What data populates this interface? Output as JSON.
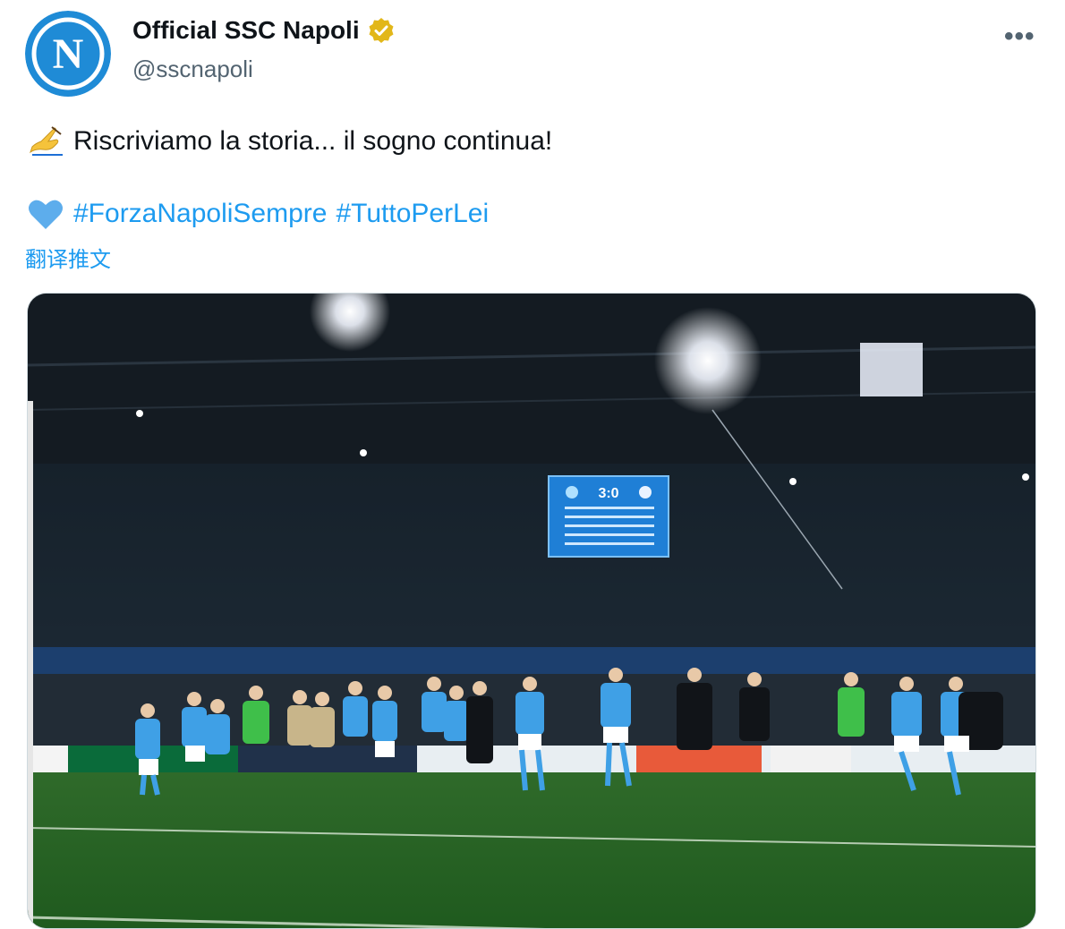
{
  "account": {
    "display_name": "Official SSC Napoli",
    "handle": "@sscnapoli",
    "avatar_letter": "N",
    "verified_color": "#e2b719"
  },
  "tweet": {
    "line1_emoji": "writing-hand-icon",
    "line1_text": "Riscriviamo la storia... il sogno continua!",
    "line2_emoji": "blue-heart-icon",
    "hashtags": [
      "#ForzaNapoliSempre",
      "#TuttoPerLei"
    ],
    "translate_label": "翻译推文"
  },
  "media": {
    "scoreboard_score": "3:0"
  },
  "colors": {
    "link": "#1d9bf0",
    "text": "#0f1419",
    "secondary": "#536471",
    "napoli_blue": "#1f8bd6"
  }
}
